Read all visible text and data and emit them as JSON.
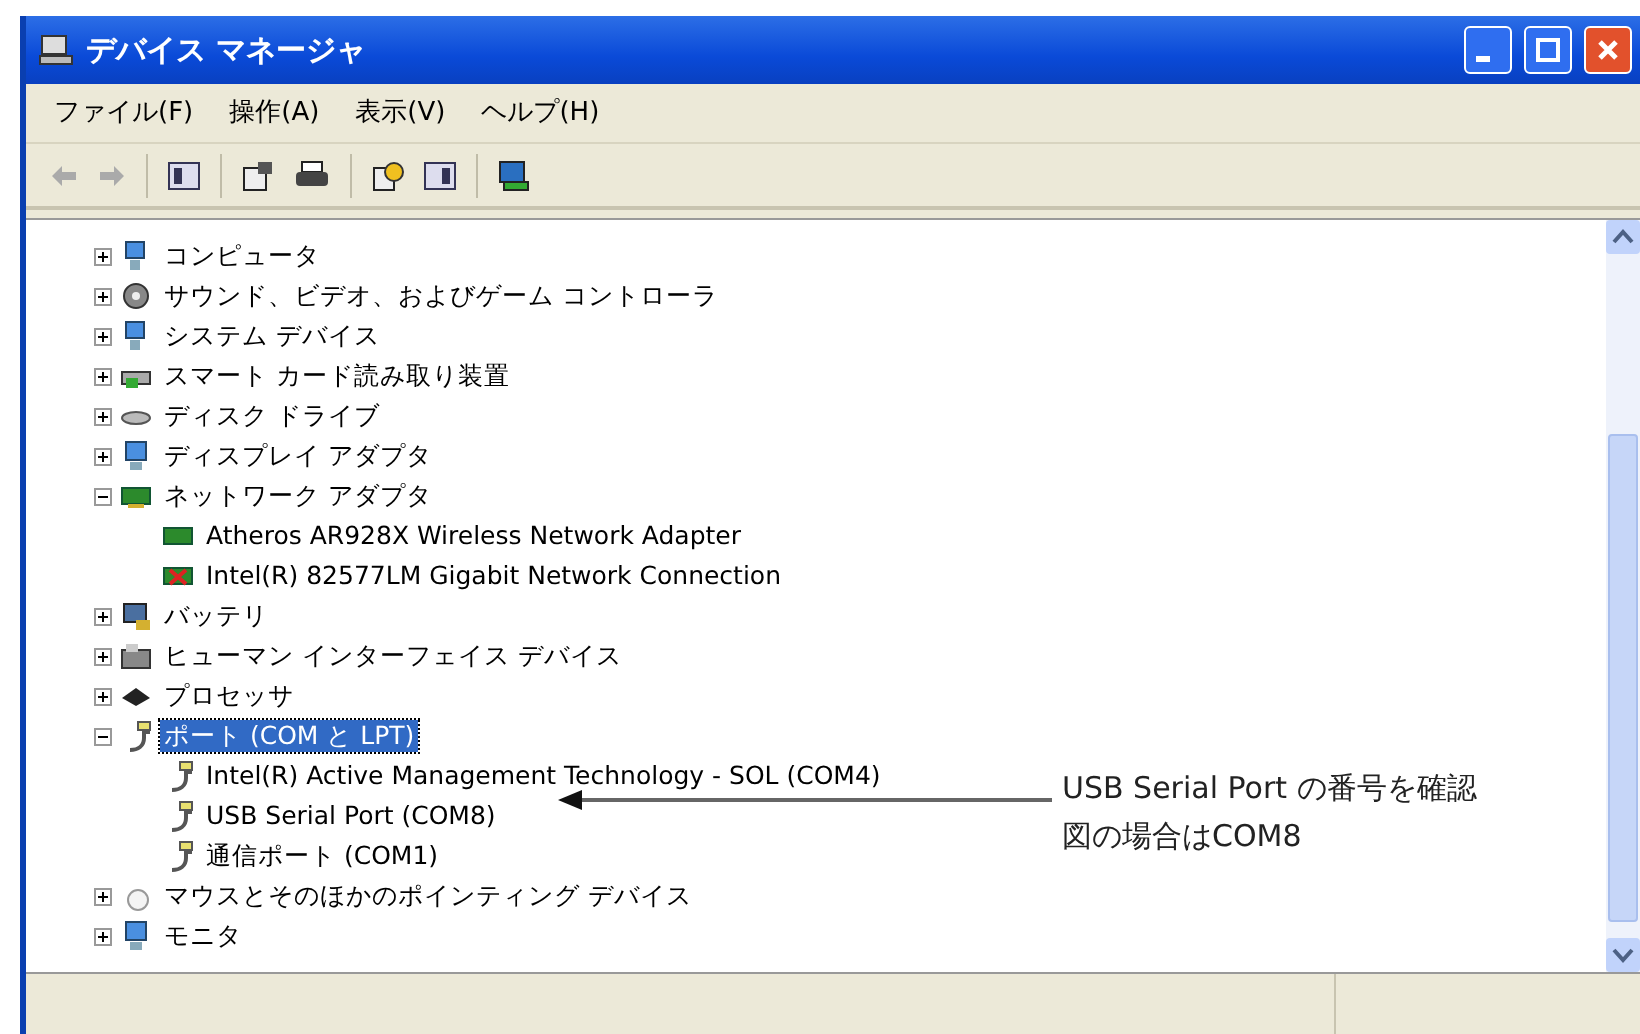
{
  "window": {
    "title": "デバイス マネージャ"
  },
  "menu": [
    "ファイル(F)",
    "操作(A)",
    "表示(V)",
    "ヘルプ(H)"
  ],
  "tree": [
    {
      "label": "コンピュータ",
      "expanded": false,
      "selected": false
    },
    {
      "label": "サウンド、ビデオ、およびゲーム コントローラ",
      "expanded": false,
      "selected": false
    },
    {
      "label": "システム デバイス",
      "expanded": false,
      "selected": false
    },
    {
      "label": "スマート カード読み取り装置",
      "expanded": false,
      "selected": false
    },
    {
      "label": "ディスク ドライブ",
      "expanded": false,
      "selected": false
    },
    {
      "label": "ディスプレイ アダプタ",
      "expanded": false,
      "selected": false
    },
    {
      "label": "ネットワーク アダプタ",
      "expanded": true,
      "selected": false,
      "children": [
        {
          "label": "Atheros AR928X Wireless Network Adapter",
          "disabled": false,
          "selected": false
        },
        {
          "label": "Intel(R) 82577LM Gigabit Network Connection",
          "disabled": true,
          "selected": false
        }
      ]
    },
    {
      "label": "バッテリ",
      "expanded": false,
      "selected": false
    },
    {
      "label": "ヒューマン インターフェイス デバイス",
      "expanded": false,
      "selected": false
    },
    {
      "label": "プロセッサ",
      "expanded": false,
      "selected": false
    },
    {
      "label": "ポート (COM と LPT)",
      "expanded": true,
      "selected": true,
      "children": [
        {
          "label": "Intel(R) Active Management Technology - SOL (COM4)",
          "disabled": false,
          "selected": false
        },
        {
          "label": "USB Serial Port (COM8)",
          "disabled": false,
          "selected": false
        },
        {
          "label": "通信ポート (COM1)",
          "disabled": false,
          "selected": false
        }
      ]
    },
    {
      "label": "マウスとそのほかのポインティング デバイス",
      "expanded": false,
      "selected": false
    },
    {
      "label": "モニタ",
      "expanded": false,
      "selected": false
    }
  ],
  "annotation": {
    "lines": [
      "USB Serial Port の番号を確認",
      "図の場合はCOM8"
    ]
  }
}
